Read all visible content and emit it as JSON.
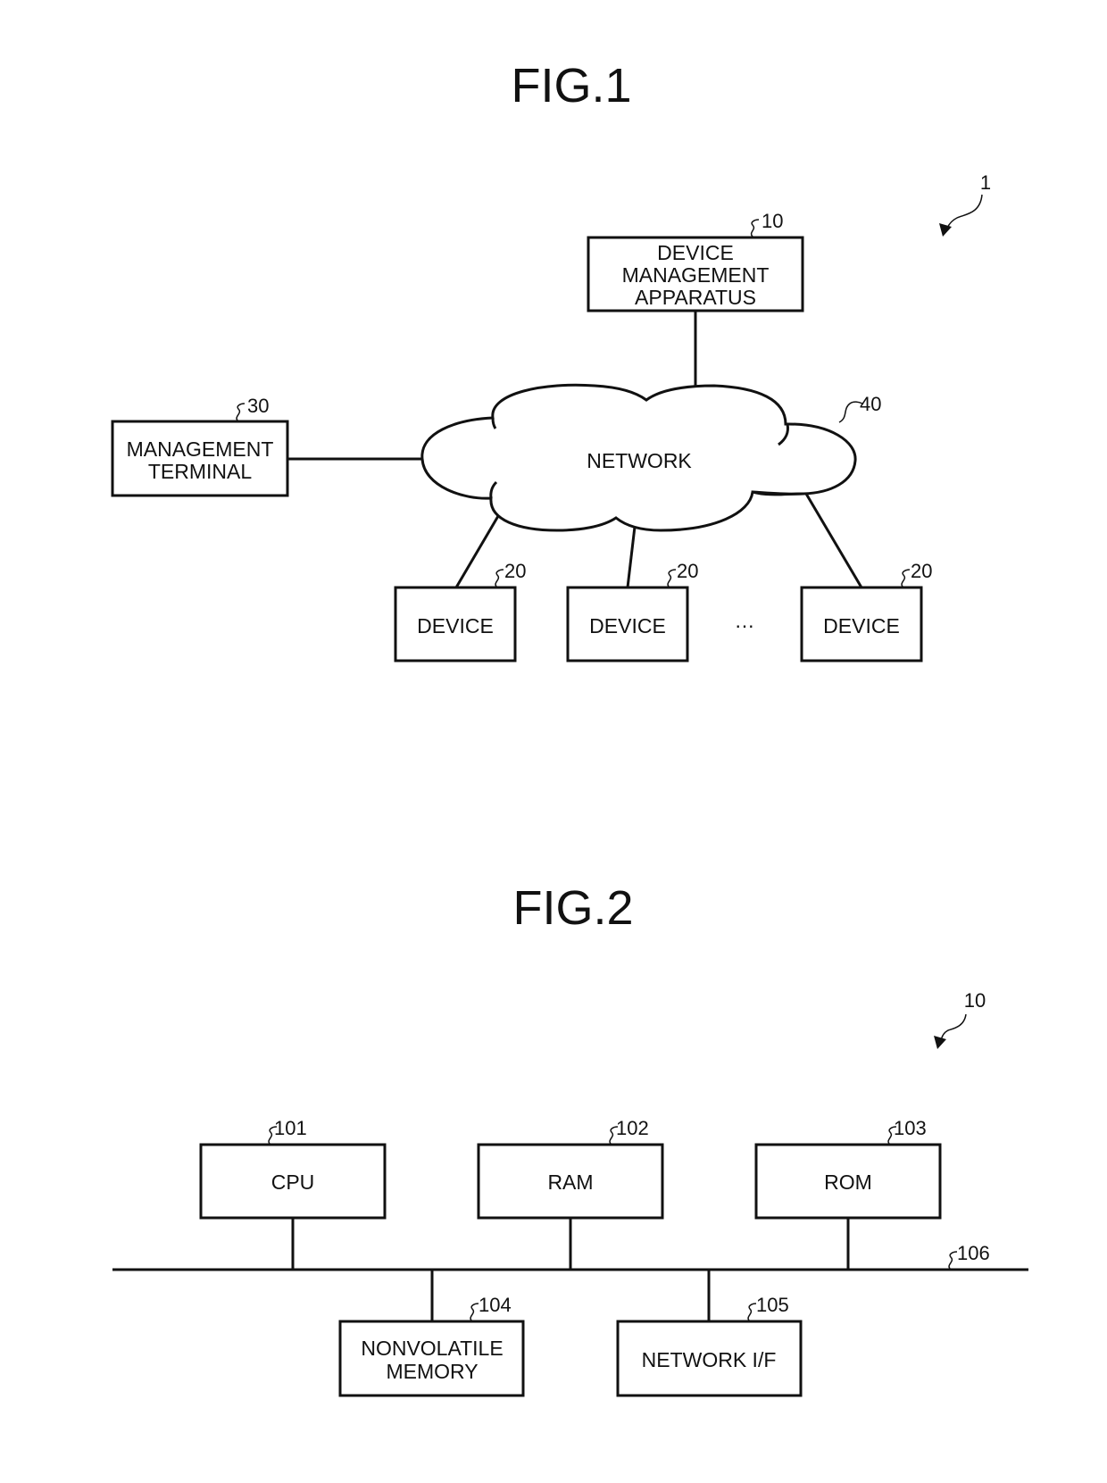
{
  "fig1": {
    "title": "FIG.1",
    "system_ref": "1",
    "device_management_apparatus": {
      "lines": [
        "DEVICE",
        "MANAGEMENT",
        "APPARATUS"
      ],
      "ref": "10"
    },
    "management_terminal": {
      "lines": [
        "MANAGEMENT",
        "TERMINAL"
      ],
      "ref": "30"
    },
    "network": {
      "label": "NETWORK",
      "ref": "40"
    },
    "devices": [
      {
        "label": "DEVICE",
        "ref": "20"
      },
      {
        "label": "DEVICE",
        "ref": "20"
      },
      {
        "label": "DEVICE",
        "ref": "20"
      }
    ],
    "ellipsis": "…"
  },
  "fig2": {
    "title": "FIG.2",
    "apparatus_ref": "10",
    "bus_ref": "106",
    "top_components": [
      {
        "lines": [
          "CPU"
        ],
        "ref": "101"
      },
      {
        "lines": [
          "RAM"
        ],
        "ref": "102"
      },
      {
        "lines": [
          "ROM"
        ],
        "ref": "103"
      }
    ],
    "bottom_components": [
      {
        "lines": [
          "NONVOLATILE",
          "MEMORY"
        ],
        "ref": "104"
      },
      {
        "lines": [
          "NETWORK I/F"
        ],
        "ref": "105"
      }
    ]
  }
}
